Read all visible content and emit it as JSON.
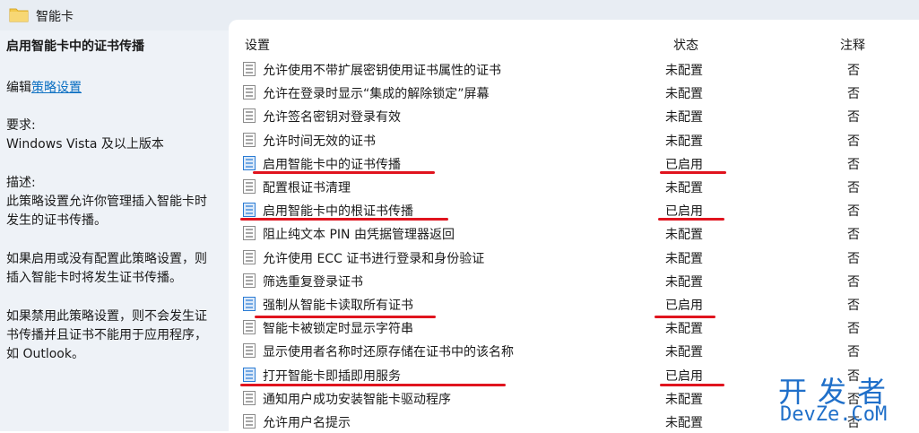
{
  "window": {
    "title": "智能卡"
  },
  "description": {
    "title": "启用智能卡中的证书传播",
    "edit_prefix": "编辑",
    "edit_link": "策略设置",
    "requirements_label": "要求:",
    "requirements_value": "Windows Vista 及以上版本",
    "desc_label": "描述:",
    "desc_line1": "此策略设置允许你管理插入智能卡时",
    "desc_line2": "发生的证书传播。",
    "enabled_line1": "如果启用或没有配置此策略设置，则",
    "enabled_line2": "插入智能卡时将发生证书传播。",
    "disabled_line1": "如果禁用此策略设置，则不会发生证",
    "disabled_line2": "书传播并且证书不能用于应用程序，",
    "disabled_line3": "如 Outlook。"
  },
  "columns": {
    "setting": "设置",
    "state": "状态",
    "note": "注释"
  },
  "rows": [
    {
      "name": "允许使用不带扩展密钥使用证书属性的证书",
      "state": "未配置",
      "note": "否"
    },
    {
      "name": "允许在登录时显示“集成的解除锁定”屏幕",
      "state": "未配置",
      "note": "否"
    },
    {
      "name": "允许签名密钥对登录有效",
      "state": "未配置",
      "note": "否"
    },
    {
      "name": "允许时间无效的证书",
      "state": "未配置",
      "note": "否"
    },
    {
      "name": "启用智能卡中的证书传播",
      "state": "已启用",
      "note": "否"
    },
    {
      "name": "配置根证书清理",
      "state": "未配置",
      "note": "否"
    },
    {
      "name": "启用智能卡中的根证书传播",
      "state": "已启用",
      "note": "否"
    },
    {
      "name": "阻止纯文本 PIN 由凭据管理器返回",
      "state": "未配置",
      "note": "否"
    },
    {
      "name": "允许使用 ECC 证书进行登录和身份验证",
      "state": "未配置",
      "note": "否"
    },
    {
      "name": "筛选重复登录证书",
      "state": "未配置",
      "note": "否"
    },
    {
      "name": "强制从智能卡读取所有证书",
      "state": "已启用",
      "note": "否"
    },
    {
      "name": "智能卡被锁定时显示字符串",
      "state": "未配置",
      "note": "否"
    },
    {
      "name": "显示使用者名称时还原存储在证书中的该名称",
      "state": "未配置",
      "note": "否"
    },
    {
      "name": "打开智能卡即插即用服务",
      "state": "已启用",
      "note": "否"
    },
    {
      "name": "通知用户成功安装智能卡驱动程序",
      "state": "未配置",
      "note": "否"
    },
    {
      "name": "允许用户名提示",
      "state": "未配置",
      "note": "否"
    }
  ],
  "colors": {
    "highlight_line": "#e0141e",
    "link": "#0b6fc2",
    "watermark": "#1f6fc9"
  },
  "icons": {
    "folder": "folder-icon",
    "policy": "policy-setting-icon"
  },
  "watermark": {
    "cn": "开发者",
    "en": "DevZe.CoM"
  }
}
